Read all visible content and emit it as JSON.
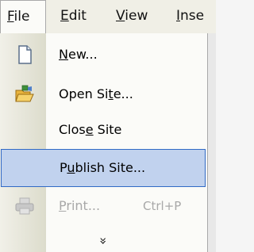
{
  "menubar": {
    "items": [
      {
        "pre": "",
        "key": "F",
        "post": "ile"
      },
      {
        "pre": "",
        "key": "E",
        "post": "dit"
      },
      {
        "pre": "",
        "key": "V",
        "post": "iew"
      },
      {
        "pre": "",
        "key": "I",
        "post": "nse"
      }
    ]
  },
  "file_menu": {
    "items": [
      {
        "pre": "",
        "key": "N",
        "post": "ew...",
        "shortcut": "",
        "icon": "new-document-icon",
        "enabled": true
      },
      {
        "pre": "Open Si",
        "key": "t",
        "post": "e...",
        "shortcut": "",
        "icon": "open-folder-icon",
        "enabled": true
      },
      {
        "pre": "Clos",
        "key": "e",
        "post": " Site",
        "shortcut": "",
        "icon": "",
        "enabled": true
      },
      {
        "pre": "P",
        "key": "u",
        "post": "blish Site...",
        "shortcut": "",
        "icon": "",
        "enabled": true,
        "highlighted": true
      },
      {
        "pre": "",
        "key": "P",
        "post": "rint...",
        "shortcut": "Ctrl+P",
        "icon": "printer-icon",
        "enabled": false
      }
    ],
    "expand_glyph": "»"
  },
  "colors": {
    "highlight_bg": "#c1d2ee",
    "highlight_border": "#316ac5",
    "disabled_text": "#a8a8a8"
  }
}
